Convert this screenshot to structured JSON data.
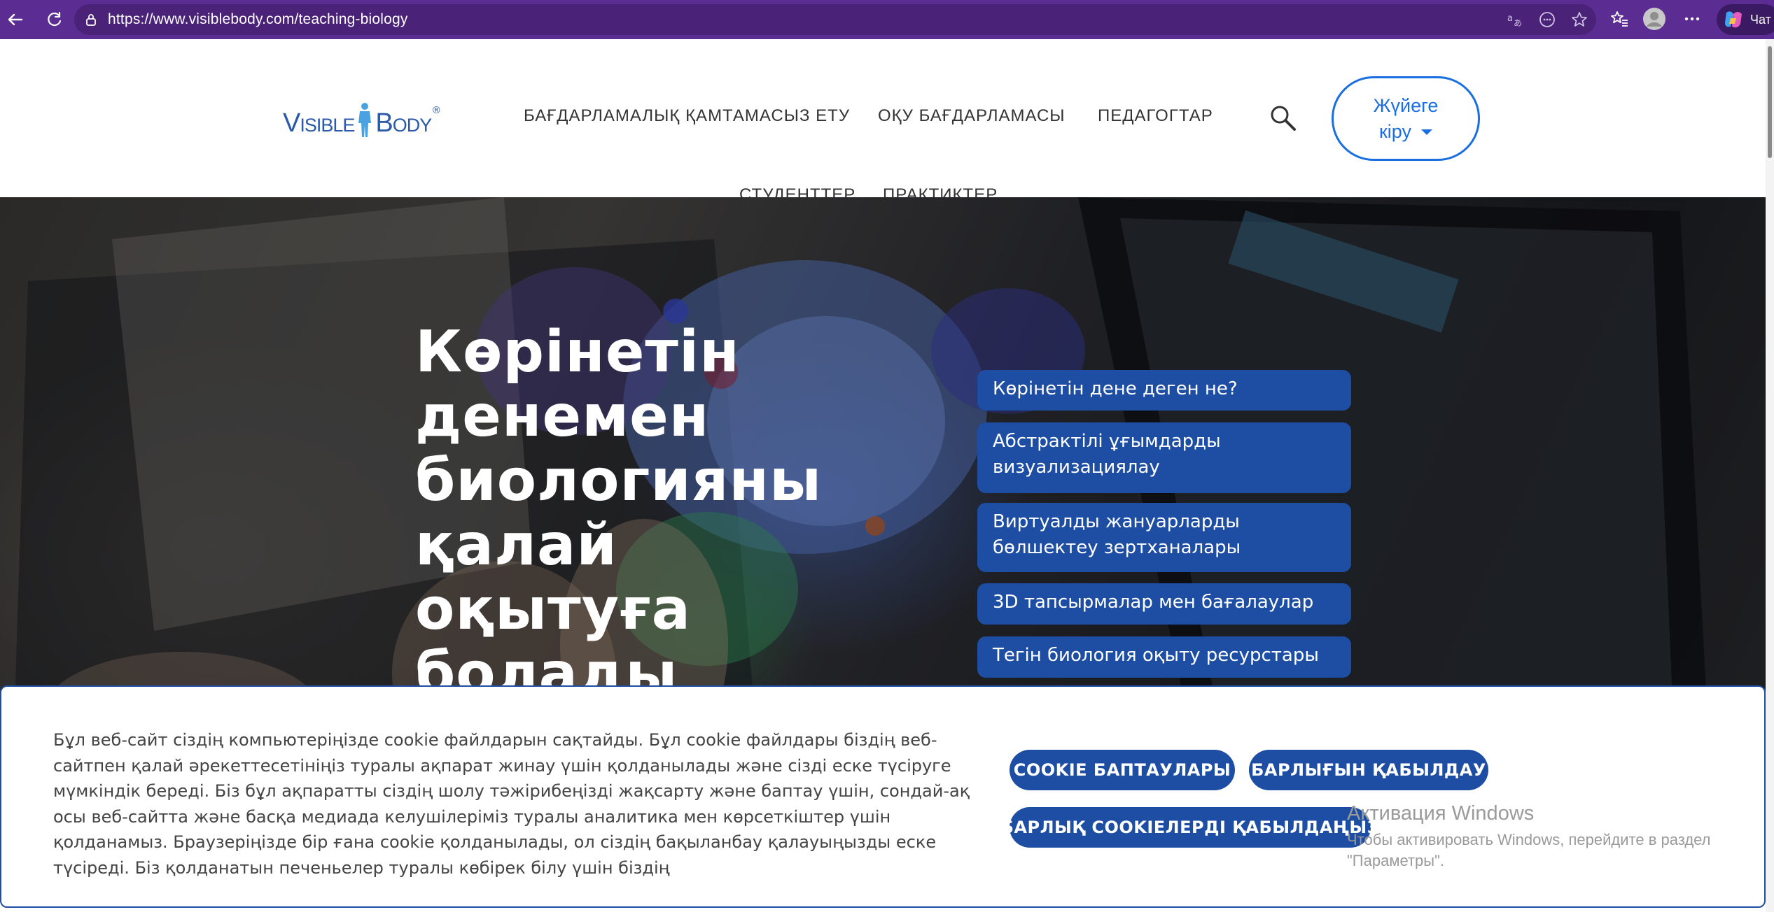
{
  "browser": {
    "url": "https://www.visiblebody.com/teaching-biology",
    "copilot_label": "Чат",
    "icons": [
      "back-arrow-icon",
      "reload-icon",
      "lock-icon",
      "translate-icon",
      "reader-icon",
      "favorite-star-icon",
      "favorites-icon",
      "profile-icon",
      "more-icon",
      "copilot-icon"
    ]
  },
  "header": {
    "logo_left": "Visible",
    "logo_right": "Body",
    "logo_mark": "®",
    "nav": {
      "software": "БАҒДАРЛАМАЛЫҚ ҚАМТАМАСЫЗ ЕТУ",
      "curriculum": "ОҚУ БАҒДАРЛАМАСЫ",
      "educators": "ПЕДАГОГТАР",
      "students": "СТУДЕНТТЕР",
      "practitioners": "ПРАКТИКТЕР"
    },
    "login_line1": "Жүйеге",
    "login_line2": "кіру"
  },
  "hero": {
    "title_lines": [
      "Көрінетін",
      "денемен",
      "биологияны",
      "қалай оқытуға",
      "болады"
    ],
    "links": [
      "Көрінетін дене деген не?",
      "Абстрактілі ұғымдарды визуализациялау",
      "Виртуалды жануарларды бөлшектеу зертханалары",
      "3D тапсырмалар мен бағалаулар",
      "Тегін биология оқыту ресурстары"
    ]
  },
  "cookie": {
    "text": "Бұл веб-сайт сіздің компьютеріңізде cookie файлдарын сақтайды. Бұл cookie файлдары біздің веб-сайтпен қалай әрекеттесетініңіз туралы ақпарат жинау үшін қолданылады және сізді еске түсіруге мүмкіндік береді. Біз бұл ақпаратты сіздің шолу тәжірибеңізді жақсарту және баптау үшін, сондай-ақ осы веб-сайтта және басқа медиада келушілеріміз туралы аналитика мен көрсеткіштер үшін қолданамыз. Браузеріңізде бір ғана cookie қолданылады, ол сіздің бақыланбау қалауыңызды еске түсіреді. Біз қолданатын печеньелер туралы көбірек білу үшін біздің",
    "settings_button": "COOKIE БАПТАУЛАРЫ",
    "accept_all_button": "БАРЛЫҒЫН ҚАБЫЛДАУ",
    "decline_all_button": "БАРЛЫҚ COOKIEЛЕРДІ ҚАБЫЛДАҢЫЗ"
  },
  "watermark": {
    "title": "Активация Windows",
    "subtitle": "Чтобы активировать Windows, перейдите в раздел \"Параметры\"."
  },
  "colors": {
    "browser_bar": "#5b2c91",
    "brand_blue": "#1d4ea3",
    "login_blue": "#1a6fe0",
    "logo_blue": "#2b5aa8"
  }
}
